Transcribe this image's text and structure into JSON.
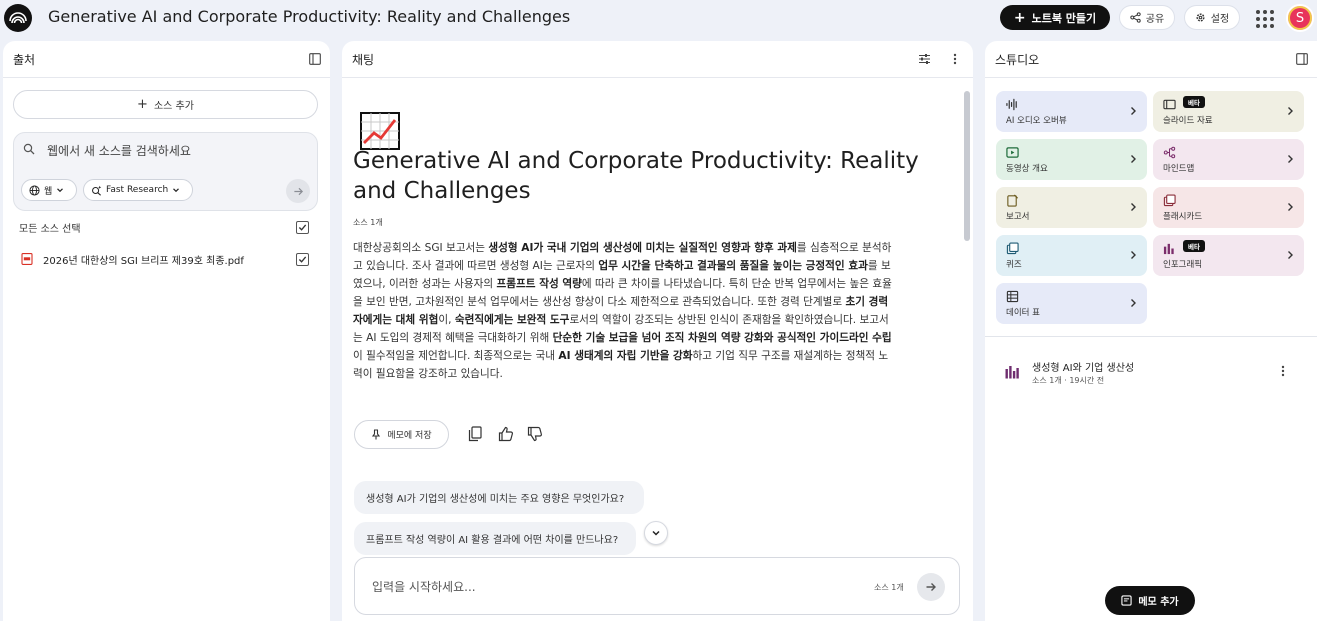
{
  "header": {
    "title": "Generative AI and Corporate Productivity: Reality and Challenges",
    "create_label": "노트북 만들기",
    "share_label": "공유",
    "settings_label": "설정",
    "avatar_letter": "S"
  },
  "sources": {
    "title": "출처",
    "add_label": "소스 추가",
    "search_placeholder": "웹에서 새 소스를 검색하세요",
    "chip_web": "웹",
    "chip_research": "Fast Research",
    "select_all": "모든 소스 선택",
    "items": [
      {
        "name": "2026년 대한상의 SGI 브리프 제39호 최종.pdf"
      }
    ]
  },
  "chat": {
    "title": "채팅",
    "doc_title": "Generative AI and Corporate Productivity: Reality and Challenges",
    "source_count": "소스 1개",
    "summary": {
      "p1": "대한상공회의소 SGI 보고서는 ",
      "b1": "생성형 AI가 국내 기업의 생산성에 미치는 실질적인 영향과 향후 과제",
      "p2": "를 심층적으로 분석하고 있습니다. 조사 결과에 따르면 생성형 AI는 근로자의 ",
      "b2": "업무 시간을 단축하고 결과물의 품질을 높이는 긍정적인 효과",
      "p3": "를 보였으나, 이러한 성과는 사용자의 ",
      "b3": "프롬프트 작성 역량",
      "p4": "에 따라 큰 차이를 나타냈습니다. 특히 단순 반복 업무에서는 높은 효율을 보인 반면, 고차원적인 분석 업무에서는 생산성 향상이 다소 제한적으로 관측되었습니다. 또한 경력 단계별로 ",
      "b4": "초기 경력자에게는 대체 위협",
      "p5": "이, ",
      "b5": "숙련직에게는 보완적 도구",
      "p6": "로서의 역할이 강조되는 상반된 인식이 존재함을 확인하였습니다. 보고서는 AI 도입의 경제적 혜택을 극대화하기 위해 ",
      "b6": "단순한 기술 보급을 넘어 조직 차원의 역량 강화와 공식적인 가이드라인 수립",
      "p7": "이 필수적임을 제언합니다. 최종적으로는 국내 ",
      "b7": "AI 생태계의 자립 기반을 강화",
      "p8": "하고 기업 직무 구조를 재설계하는 정책적 노력이 필요함을 강조하고 있습니다."
    },
    "save_note_label": "메모에 저장",
    "suggestions": [
      "생성형 AI가 기업의 생산성에 미치는 주요 영향은 무엇인가요?",
      "프롬프트 작성 역량이 AI 활용 결과에 어떤 차이를 만드나요?"
    ],
    "input_placeholder": "입력을 시작하세요...",
    "input_source_count": "소스 1개"
  },
  "studio": {
    "title": "스튜디오",
    "beta_label": "베타",
    "tiles": [
      {
        "label": "AI 오디오 오버뷰",
        "color": "#e6eaf8",
        "icon": "audio-wave-icon"
      },
      {
        "label": "슬라이드 자료",
        "color": "#f0efe3",
        "icon": "slides-icon",
        "beta": true
      },
      {
        "label": "동영상 개요",
        "color": "#e1f1e6",
        "icon": "video-icon"
      },
      {
        "label": "마인드맵",
        "color": "#f3e7ef",
        "icon": "mindmap-icon"
      },
      {
        "label": "보고서",
        "color": "#f0efe3",
        "icon": "report-icon"
      },
      {
        "label": "플래시카드",
        "color": "#f6e6e7",
        "icon": "flashcard-icon"
      },
      {
        "label": "퀴즈",
        "color": "#e0eff5",
        "icon": "quiz-icon"
      },
      {
        "label": "인포그래픽",
        "color": "#f3e7ef",
        "icon": "infographic-icon",
        "beta": true
      },
      {
        "label": "데이터 표",
        "color": "#e6eaf8",
        "icon": "table-icon"
      }
    ],
    "note": {
      "title": "생성형 AI와 기업 생산성",
      "meta": "소스 1개 · 19시간 전"
    },
    "add_note_label": "메모 추가"
  }
}
